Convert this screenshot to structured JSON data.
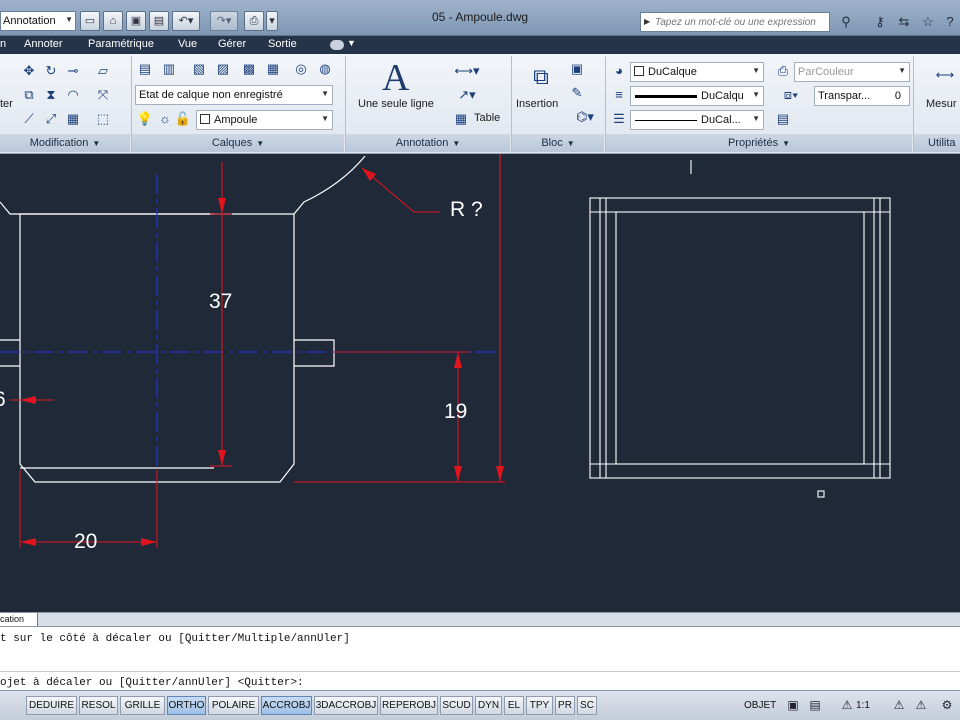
{
  "titlebar": {
    "workspace": "Annotation",
    "document_title": "05 - Ampoule.dwg",
    "search_placeholder": "Tapez un mot-clé ou une expression",
    "quick_access_icons": [
      "new-icon",
      "open-icon",
      "save-icon",
      "saveas-icon",
      "undo-icon",
      "redo-icon",
      "print-icon"
    ],
    "right_icons": [
      "binoculars-icon",
      "key-icon",
      "exchange-icon",
      "star-icon"
    ]
  },
  "menubar": {
    "items": [
      "n",
      "Annoter",
      "Paramétrique",
      "Vue",
      "Gérer",
      "Sortie"
    ]
  },
  "ribbon": {
    "modification": {
      "title": "Modification",
      "cut_label": "ter"
    },
    "layers": {
      "title": "Calques",
      "layer_state": "Etat de calque non enregistré",
      "current_layer": "Ampoule"
    },
    "annotation": {
      "title": "Annotation",
      "text_label": "Une seule ligne",
      "table_label": "Table"
    },
    "block": {
      "title": "Bloc",
      "insert_label": "Insertion"
    },
    "properties": {
      "title": "Propriétés",
      "color": "DuCalque",
      "lineweight": "DuCalqu",
      "linetype": "DuCal...",
      "plot_style": "ParCouleur",
      "transparency_label": "Transpar...",
      "transparency_value": "0"
    },
    "utilities": {
      "title": "Utilita",
      "measure_label": "Mesur"
    }
  },
  "drawing": {
    "dimensions": [
      "37",
      "19",
      "20",
      "6",
      "R ?"
    ],
    "colors": {
      "background": "#1f2938",
      "geometry": "#ffffff",
      "dimension": "#e0141e",
      "centerline": "#2433c8"
    }
  },
  "tabs": {
    "layout_tab": "cation"
  },
  "command": {
    "history_line": "t sur le côté à décaler ou [Quitter/Multiple/annUler]",
    "prompt_line": "ojet à décaler ou [Quitter/annUler] <Quitter>:"
  },
  "statusbar": {
    "toggles": [
      {
        "label": "DEDUIRE",
        "on": false
      },
      {
        "label": "RESOL",
        "on": false
      },
      {
        "label": "GRILLE",
        "on": false
      },
      {
        "label": "ORTHO",
        "on": true
      },
      {
        "label": "POLAIRE",
        "on": false
      },
      {
        "label": "ACCROBJ",
        "on": true
      },
      {
        "label": "3DACCROBJ",
        "on": false
      },
      {
        "label": "REPEROBJ",
        "on": false
      },
      {
        "label": "SCUD",
        "on": false
      },
      {
        "label": "DYN",
        "on": false
      },
      {
        "label": "EL",
        "on": false
      },
      {
        "label": "TPY",
        "on": false
      },
      {
        "label": "PR",
        "on": false
      },
      {
        "label": "SC",
        "on": false
      }
    ],
    "model_label": "OBJET",
    "scale_label": "1:1"
  }
}
